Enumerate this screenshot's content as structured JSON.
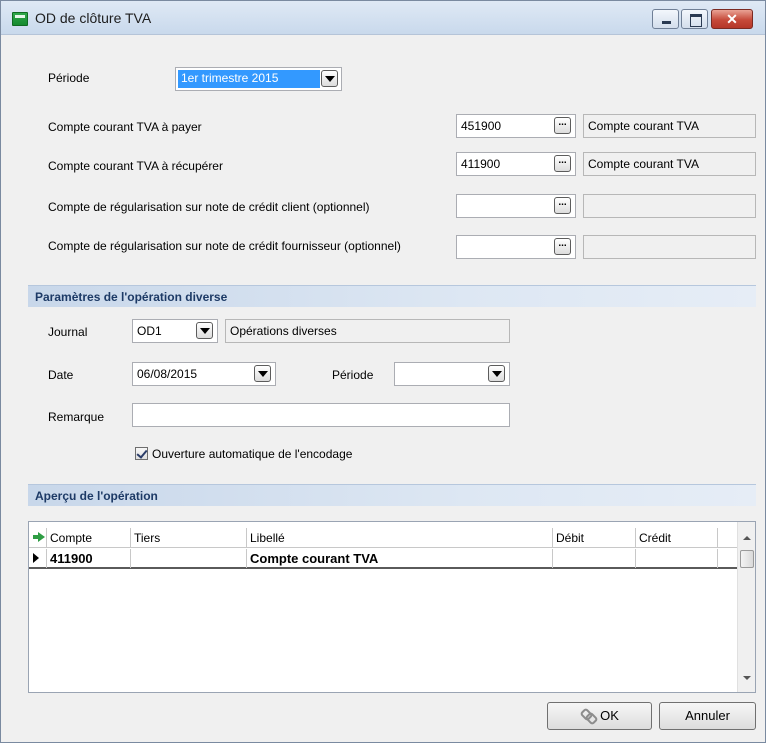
{
  "window": {
    "title": "OD de clôture TVA"
  },
  "top": {
    "periode_label": "Période",
    "periode_value": "1er trimestre 2015",
    "rows": [
      {
        "label": "Compte courant TVA à payer",
        "value": "451900",
        "desc": "Compte courant TVA"
      },
      {
        "label": "Compte courant TVA à récupérer",
        "value": "411900",
        "desc": "Compte courant TVA"
      },
      {
        "label": "Compte de régularisation sur note de crédit client (optionnel)",
        "value": "",
        "desc": ""
      },
      {
        "label": "Compte de régularisation sur note de crédit fournisseur (optionnel)",
        "value": "",
        "desc": ""
      }
    ]
  },
  "params": {
    "section_title": "Paramètres de l'opération diverse",
    "journal_label": "Journal",
    "journal_value": "OD1",
    "journal_desc": "Opérations diverses",
    "date_label": "Date",
    "date_value": "06/08/2015",
    "periode_label": "Période",
    "periode_value": "",
    "remarque_label": "Remarque",
    "remarque_value": "",
    "auto_open_label": "Ouverture automatique de l'encodage",
    "auto_open_checked": true
  },
  "preview": {
    "section_title": "Aperçu de l'opération",
    "columns": [
      "Compte",
      "Tiers",
      "Libellé",
      "Débit",
      "Crédit"
    ],
    "rows": [
      {
        "compte": "411900",
        "tiers": "",
        "libelle": "Compte courant TVA",
        "debit": "",
        "credit": ""
      }
    ]
  },
  "buttons": {
    "ok": "OK",
    "cancel": "Annuler"
  }
}
